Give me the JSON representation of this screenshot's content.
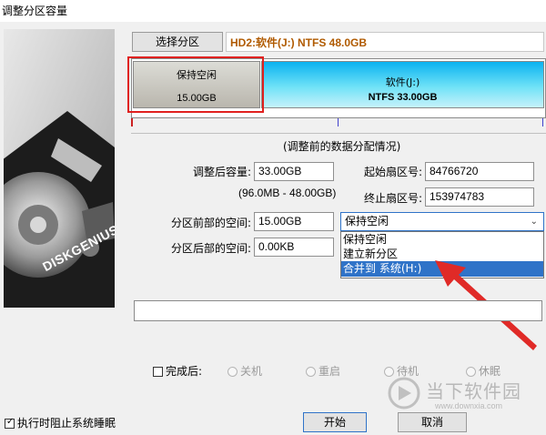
{
  "window": {
    "title": "调整分区容量"
  },
  "header": {
    "select_partition_label": "选择分区",
    "partition_info": "HD2:软件(J:) NTFS 48.0GB"
  },
  "bar": {
    "free_block": {
      "name": "保持空闲",
      "size": "15.00GB"
    },
    "part_block": {
      "name": "软件(J:)",
      "detail": "NTFS 33.00GB"
    }
  },
  "section_caption": "(调整前的数据分配情况)",
  "form": {
    "size_after_label": "调整后容量:",
    "size_after_value": "33.00GB",
    "range_text": "(96.0MB - 48.00GB)",
    "start_sector_label": "起始扇区号:",
    "start_sector_value": "84766720",
    "end_sector_label": "终止扇区号:",
    "end_sector_value": "153974783",
    "space_before_label": "分区前部的空间:",
    "space_before_value": "15.00GB",
    "space_after_label": "分区后部的空间:",
    "space_after_value": "0.00KB"
  },
  "dropdown": {
    "selected": "保持空闲",
    "options": [
      "保持空闲",
      "建立新分区",
      "合并到 系统(H:)"
    ],
    "highlighted_index": 2
  },
  "after_done": {
    "checkbox_label": "完成后:",
    "options": [
      "关机",
      "重启",
      "待机",
      "休眠"
    ]
  },
  "footer": {
    "prevent_sleep_label": "执行时阻止系统睡眠",
    "start_button": "开始",
    "cancel_button": "取消"
  },
  "sidepanel": {
    "brand": "DISKGENIUS"
  },
  "watermark": {
    "name": "当下软件园",
    "url": "www.downxia.com"
  },
  "colors": {
    "highlight_box": "#e0211f",
    "arrow": "#e02a27",
    "partition_blue": "#35d0f2",
    "selection_blue": "#2f73c8"
  }
}
